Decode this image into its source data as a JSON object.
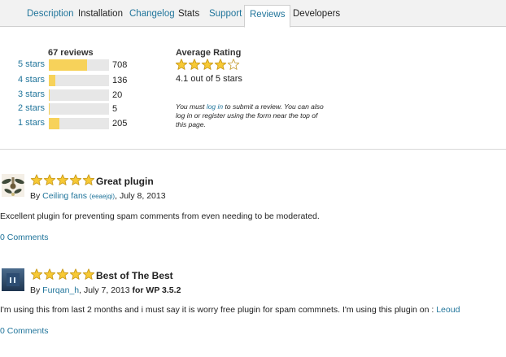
{
  "tabs": [
    {
      "label": "Description",
      "style": "link"
    },
    {
      "label": "Installation",
      "style": "dark"
    },
    {
      "label": "Changelog",
      "style": "link"
    },
    {
      "label": "Stats",
      "style": "dark"
    },
    {
      "label": "Support",
      "style": "link"
    },
    {
      "label": "Reviews",
      "style": "active"
    },
    {
      "label": "Developers",
      "style": "dark"
    }
  ],
  "summary": {
    "title": "67 reviews",
    "rows": [
      {
        "label": "5 stars",
        "count": "708",
        "fill_fraction": 0.64
      },
      {
        "label": "4 stars",
        "count": "136",
        "fill_fraction": 0.11
      },
      {
        "label": "3 stars",
        "count": "20",
        "fill_fraction": 0.02
      },
      {
        "label": "2 stars",
        "count": "5",
        "fill_fraction": 0.005
      },
      {
        "label": "1 stars",
        "count": "205",
        "fill_fraction": 0.18
      }
    ]
  },
  "average": {
    "title": "Average Rating",
    "stars_filled": 4,
    "text": "4.1 out of 5 stars",
    "notice_before": "You must ",
    "notice_link": "log in",
    "notice_after": " to submit a review. You can also log in or register using the form near the top of this page."
  },
  "colors": {
    "link": "#21759b",
    "bar_fill": "#f7d25a",
    "bar_track": "#e7e7e7",
    "star": "#f5c518"
  },
  "reviews": [
    {
      "title": "Great plugin",
      "stars_filled": 5,
      "by": "By ",
      "author": "Ceiling fans",
      "handle": "(eeaejqi)",
      "date": ", July 8, 2013",
      "version": "",
      "body": "Excellent plugin for preventing spam comments from even needing to be moderated.",
      "body_link": "",
      "comments": "0 Comments",
      "avatar_icon": "ceiling-fan-avatar-icon"
    },
    {
      "title": "Best of The Best",
      "stars_filled": 5,
      "by": "By ",
      "author": "Furqan_h",
      "handle": "",
      "date": ", July 7, 2013 ",
      "version": "for WP 3.5.2",
      "body": "I'm using this from last 2 months and i must say it is worry free plugin for spam commnets. I'm using this plugin on : ",
      "body_link": "Leoud",
      "comments": "0 Comments",
      "avatar_icon": "blue-square-avatar-icon"
    }
  ]
}
